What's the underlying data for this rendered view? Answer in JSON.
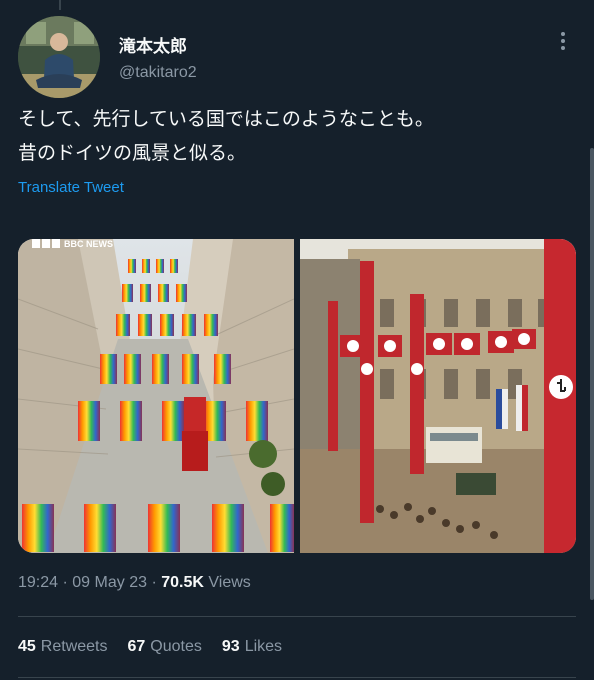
{
  "user": {
    "display_name": "滝本太郎",
    "handle": "@takitaro2"
  },
  "tweet": {
    "lines": [
      "そして、先行している国ではこのようなことも。",
      "昔のドイツの風景と似る。"
    ],
    "translate_label": "Translate Tweet"
  },
  "media": {
    "left_watermark": "BBC NEWS"
  },
  "meta": {
    "time": "19:24",
    "date": "09 May 23",
    "views_count": "70.5K",
    "views_label": "Views",
    "sep": "·"
  },
  "stats": {
    "retweets_count": "45",
    "retweets_label": "Retweets",
    "quotes_count": "67",
    "quotes_label": "Quotes",
    "likes_count": "93",
    "likes_label": "Likes"
  },
  "colors": {
    "background": "#15202b",
    "link": "#1d9bf0",
    "secondary_text": "#8b98a5"
  },
  "icons": [
    "more-options-icon"
  ]
}
